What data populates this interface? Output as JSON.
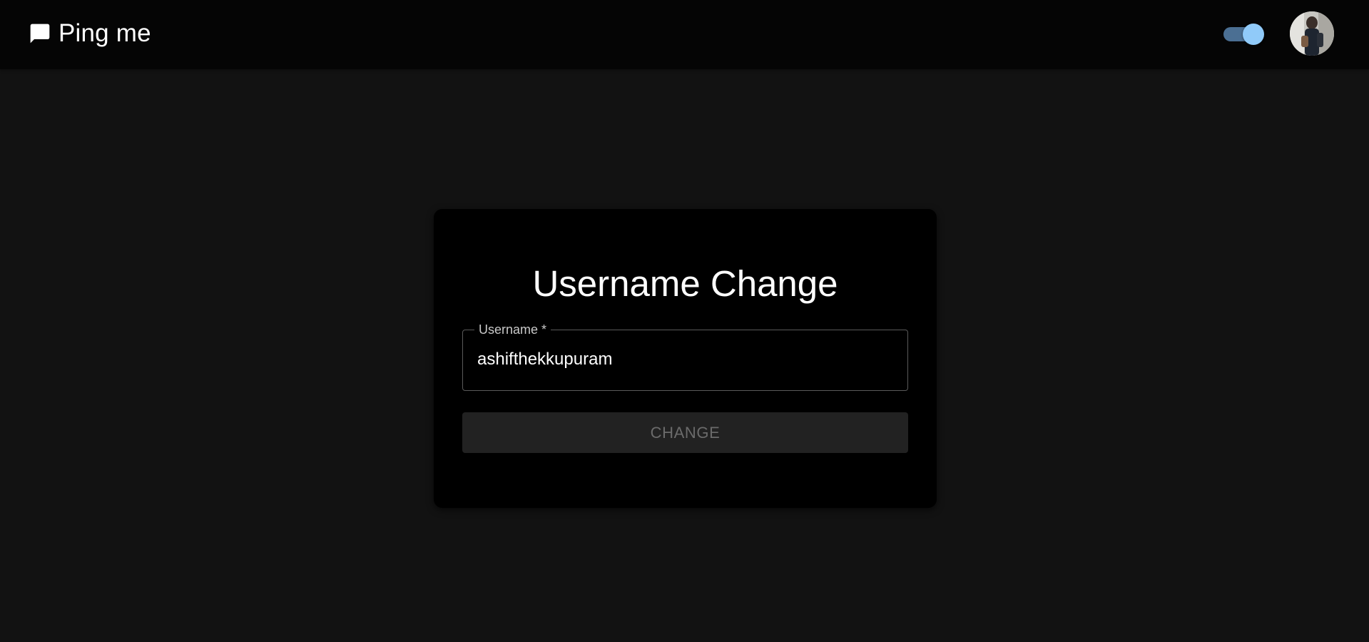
{
  "header": {
    "app_name": "Ping me",
    "logo_icon": "chat-bubble-icon",
    "theme_toggle": {
      "checked": true,
      "accent": "#90caf9"
    },
    "avatar_icon": "user-avatar"
  },
  "form": {
    "title": "Username Change",
    "username_label": "Username *",
    "username_value": "ashifthekkupuram",
    "submit_label": "CHANGE",
    "submit_disabled": true
  },
  "colors": {
    "background": "#121212",
    "appbar": "#050505",
    "card": "#000000",
    "button_disabled": "#222222"
  }
}
